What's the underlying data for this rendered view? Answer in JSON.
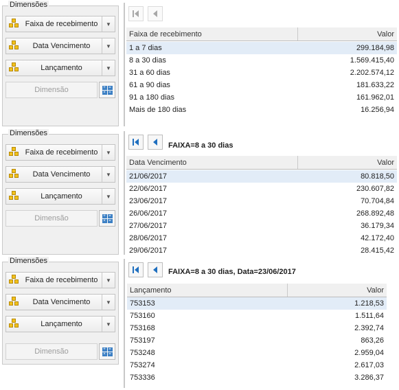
{
  "panels": [
    {
      "dims_legend": "Dimensões",
      "dim_buttons": [
        "Faixa de recebimento",
        "Data Vencimento",
        "Lançamento"
      ],
      "dim_empty_label": "Dimensão",
      "breadcrumb": "",
      "nav_disabled": true,
      "table": {
        "col1": "Faixa de recebimento",
        "col2": "Valor",
        "rows": [
          {
            "label": "1 a 7 dias",
            "value": "299.184,98",
            "selected": true
          },
          {
            "label": "8 a 30 dias",
            "value": "1.569.415,40"
          },
          {
            "label": "31 a 60 dias",
            "value": "2.202.574,12"
          },
          {
            "label": "61 a 90 dias",
            "value": "181.633,22"
          },
          {
            "label": "91 a 180 dias",
            "value": "161.962,01"
          },
          {
            "label": "Mais de 180 dias",
            "value": "16.256,94"
          }
        ]
      }
    },
    {
      "dims_legend": "Dimensões",
      "dim_buttons": [
        "Faixa de recebimento",
        "Data Vencimento",
        "Lançamento"
      ],
      "dim_empty_label": "Dimensão",
      "breadcrumb": "FAIXA=8 a 30 dias",
      "nav_disabled": false,
      "table": {
        "col1": "Data Vencimento",
        "col2": "Valor",
        "rows": [
          {
            "label": "21/06/2017",
            "value": "80.818,50",
            "selected": true
          },
          {
            "label": "22/06/2017",
            "value": "230.607,82"
          },
          {
            "label": "23/06/2017",
            "value": "70.704,84"
          },
          {
            "label": "26/06/2017",
            "value": "268.892,48"
          },
          {
            "label": "27/06/2017",
            "value": "36.179,34"
          },
          {
            "label": "28/06/2017",
            "value": "42.172,40"
          },
          {
            "label": "29/06/2017",
            "value": "28.415,42"
          }
        ]
      }
    },
    {
      "dims_legend": "Dimensões",
      "dim_buttons": [
        "Faixa de recebimento",
        "Data Vencimento",
        "Lançamento"
      ],
      "dim_empty_label": "Dimensão",
      "breadcrumb": "FAIXA=8 a 30 dias, Data=23/06/2017",
      "nav_disabled": false,
      "table": {
        "col1": "Lançamento",
        "col2": "Valor",
        "rows": [
          {
            "label": "753153",
            "value": "1.218,53",
            "selected": true
          },
          {
            "label": "753160",
            "value": "1.511,64"
          },
          {
            "label": "753168",
            "value": "2.392,74"
          },
          {
            "label": "753197",
            "value": "863,26"
          },
          {
            "label": "753248",
            "value": "2.959,04"
          },
          {
            "label": "753274",
            "value": "2.617,03"
          },
          {
            "label": "753336",
            "value": "3.286,37"
          }
        ]
      }
    }
  ],
  "colors": {
    "accent": "#1f6fbf",
    "selected_row": "#e2ecf7",
    "header_bg": "#f0f0f0"
  },
  "icons": {
    "dimension": "dimension-cubes-icon",
    "first": "first-page-icon",
    "prev": "previous-page-icon",
    "dropdown": "chevron-down-icon",
    "grid": "grid-config-icon"
  }
}
